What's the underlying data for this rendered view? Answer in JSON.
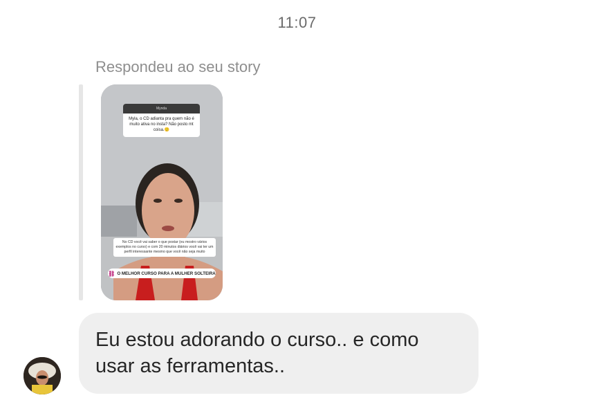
{
  "header": {
    "timestamp": "11:07"
  },
  "reply_context": {
    "label": "Respondeu ao seu story"
  },
  "story": {
    "question_box": {
      "header": "Mynda",
      "text": "Myla, o CD adianta pra quem não é muito ativa no insta? Não posto mt coisa.🙂"
    },
    "caption": "No CD você vai saber o que postar (eu mostro vários exemplos no curso) e com 20 minutos diários você vai ter um perfil interessante mesmo que você não seja muito",
    "link_sticker": {
      "icon": "link-icon",
      "text": "O MELHOR CURSO PARA A MULHER SOLTEIRA"
    }
  },
  "message": {
    "line1": "Eu estou adorando o curso.. e como",
    "line2": "usar as ferramentas.."
  },
  "colors": {
    "bubble_bg": "#efefef",
    "text_primary": "#262626",
    "text_secondary": "#8e8e8e",
    "link_accent": "#c13584"
  }
}
